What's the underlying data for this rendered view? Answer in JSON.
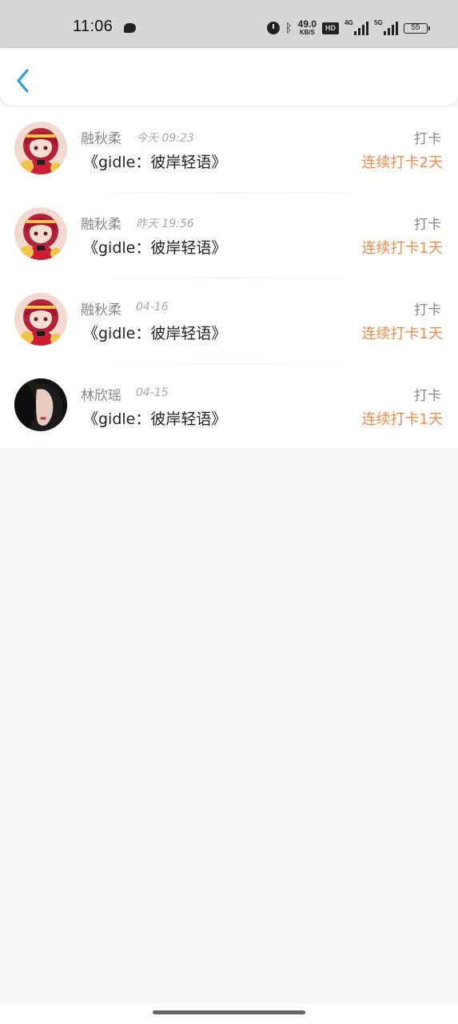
{
  "status_bar": {
    "time": "11:06",
    "speed_value": "49.0",
    "speed_unit": "KB/S",
    "hd_label": "HD",
    "net1": "4G",
    "net2": "5G",
    "battery": "55",
    "icons": [
      "message-icon",
      "alarm-icon",
      "bluetooth-icon",
      "hd-icon",
      "signal-4g-icon",
      "signal-5g-icon",
      "battery-icon"
    ]
  },
  "header": {
    "back_icon": "chevron-left-icon"
  },
  "checkins": [
    {
      "name": "融秋柔",
      "time": "今天 09:23",
      "title": "《gidle：彼岸轻语》",
      "action": "打卡",
      "streak": "连续打卡2天",
      "avatar": "anime-avatar"
    },
    {
      "name": "融秋柔",
      "time": "昨天 19:56",
      "title": "《gidle：彼岸轻语》",
      "action": "打卡",
      "streak": "连续打卡1天",
      "avatar": "anime-avatar"
    },
    {
      "name": "融秋柔",
      "time": "04-16",
      "title": "《gidle：彼岸轻语》",
      "action": "打卡",
      "streak": "连续打卡1天",
      "avatar": "anime-avatar"
    },
    {
      "name": "林欣瑶",
      "time": "04-15",
      "title": "《gidle：彼岸轻语》",
      "action": "打卡",
      "streak": "连续打卡1天",
      "avatar": "photo-avatar"
    }
  ],
  "colors": {
    "accent": "#f08a4b",
    "back": "#2b9be0",
    "background": "#f9f8f8"
  }
}
